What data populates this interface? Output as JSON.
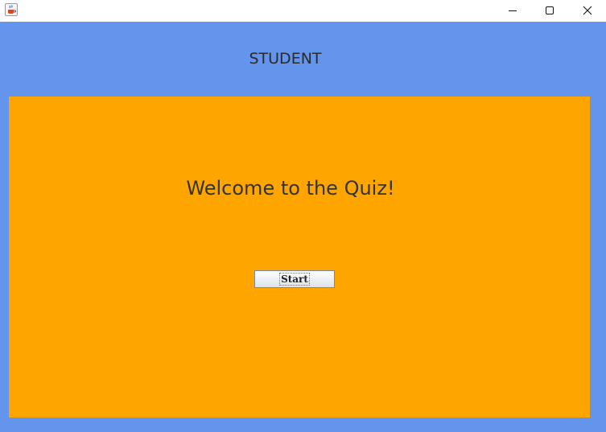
{
  "window": {
    "icon": "java-cup-icon",
    "controls": {
      "minimize_icon": "minimize-icon",
      "maximize_icon": "maximize-icon",
      "close_icon": "close-icon"
    }
  },
  "header": {
    "title": "STUDENT"
  },
  "main": {
    "welcome_text": "Welcome to the Quiz!",
    "start_label": "Start"
  },
  "colors": {
    "background": "#6495ED",
    "panel": "#FFA500",
    "titlebar": "#FFFFFF"
  }
}
